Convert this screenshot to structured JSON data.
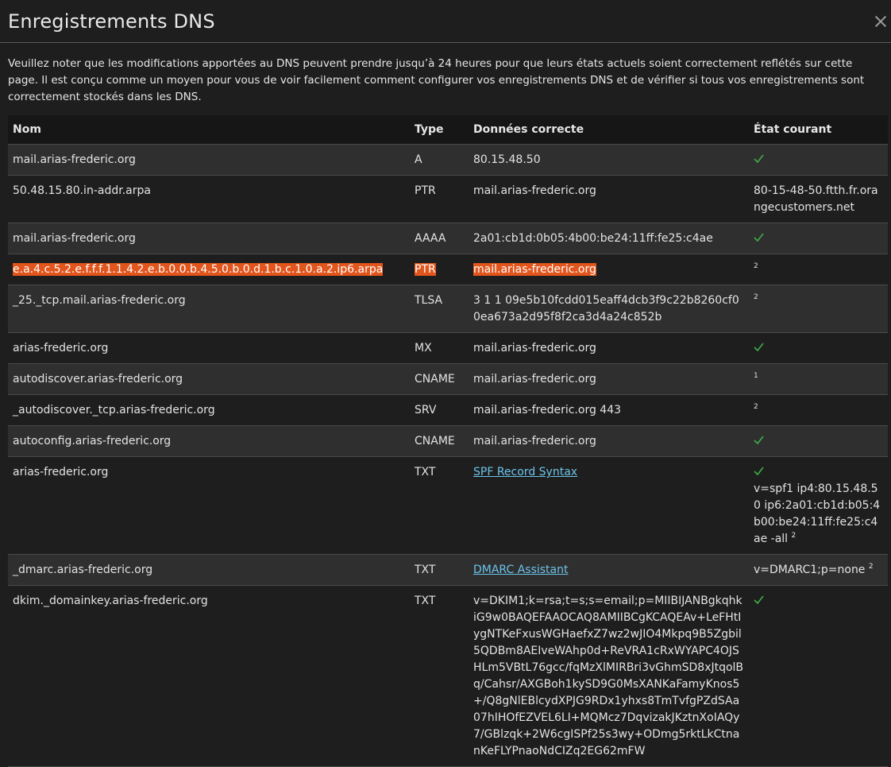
{
  "header": {
    "title": "Enregistrements DNS",
    "close_label": "×"
  },
  "notice": "Veuillez noter que les modifications apportées au DNS peuvent prendre jusqu’à 24 heures pour que leurs états actuels soient correctement reflétés sur cette page. Il est conçu comme un moyen pour vous de voir facilement comment configurer vos enregistrements DNS et de vérifier si tous vos enregistrements sont correctement stockés dans les DNS.",
  "table": {
    "headers": {
      "name": "Nom",
      "type": "Type",
      "data": "Données correcte",
      "status": "État courant"
    },
    "rows": [
      {
        "name": "mail.arias-frederic.org",
        "type": "A",
        "data": "80.15.48.50",
        "status_text": "",
        "status_sup": "",
        "check": true
      },
      {
        "name": "50.48.15.80.in-addr.arpa",
        "type": "PTR",
        "data": "mail.arias-frederic.org",
        "status_text": "80-15-48-50.ftth.fr.orangecustomers.net",
        "status_sup": "",
        "check": false
      },
      {
        "name": "mail.arias-frederic.org",
        "type": "AAAA",
        "data": "2a01:cb1d:0b05:4b00:be24:11ff:fe25:c4ae",
        "status_text": "",
        "status_sup": "",
        "check": true
      },
      {
        "name": "e.a.4.c.5.2.e.f.f.f.1.1.4.2.e.b.0.0.b.4.5.0.b.0.d.1.b.c.1.0.a.2.ip6.arpa",
        "type": "PTR",
        "data": "mail.arias-frederic.org",
        "status_text": "",
        "status_sup": "2",
        "check": false,
        "highlight": true
      },
      {
        "name": "_25._tcp.mail.arias-frederic.org",
        "type": "TLSA",
        "data": "3 1 1 09e5b10fcdd015eaff4dcb3f9c22b8260cf00ea673a2d95f8f2ca3d4a24c852b",
        "status_text": "",
        "status_sup": "2",
        "check": false
      },
      {
        "name": "arias-frederic.org",
        "type": "MX",
        "data": "mail.arias-frederic.org",
        "status_text": "",
        "status_sup": "",
        "check": true
      },
      {
        "name": "autodiscover.arias-frederic.org",
        "type": "CNAME",
        "data": "mail.arias-frederic.org",
        "status_text": "",
        "status_sup": "1",
        "check": false
      },
      {
        "name": "_autodiscover._tcp.arias-frederic.org",
        "type": "SRV",
        "data": "mail.arias-frederic.org 443",
        "status_text": "",
        "status_sup": "2",
        "check": false
      },
      {
        "name": "autoconfig.arias-frederic.org",
        "type": "CNAME",
        "data": "mail.arias-frederic.org",
        "status_text": "",
        "status_sup": "",
        "check": true
      },
      {
        "name": "arias-frederic.org",
        "type": "TXT",
        "data_link": "SPF Record Syntax",
        "status_text": "v=spf1 ip4:80.15.48.50 ip6:2a01:cb1d:b05:4b00:be24:11ff:fe25:c4ae -all",
        "status_sup": "2",
        "check": true
      },
      {
        "name": "_dmarc.arias-frederic.org",
        "type": "TXT",
        "data_link": "DMARC Assistant",
        "status_text": "v=DMARC1;p=none",
        "status_sup": "2",
        "check": false
      },
      {
        "name": "dkim._domainkey.arias-frederic.org",
        "type": "TXT",
        "data": "v=DKIM1;k=rsa;t=s;s=email;p=MIIBIJANBgkqhkiG9w0BAQEFAAOCAQ8AMIIBCgKCAQEAv+LeFHtIygNTKeFxusWGHaefxZ7wz2wJIO4Mkpq9B5Zgbil5QDBm8AEIveWAhp0d+ReVRA1cRxWYAPC4OJSHLm5VBtL76gcc/fqMzXlMIRBri3vGhmSD8xJtqolBq/Cahsr/AXGBoh1kySD9G0MsXANKaFamyKnos5+/Q8gNlEBlcydXPJG9RDx1yhxs8TmTvfgPZdSAa07hIHOfEZVEL6LI+MQMcz7DqvizakJKztnXoIAQy7/GBlzqk+2W6cgISPf25s3wy+ODmg5rktLkCtnanKeFLYPnaoNdCIZq2EG62mFW",
        "status_text": "",
        "status_sup": "",
        "check": true
      }
    ]
  }
}
